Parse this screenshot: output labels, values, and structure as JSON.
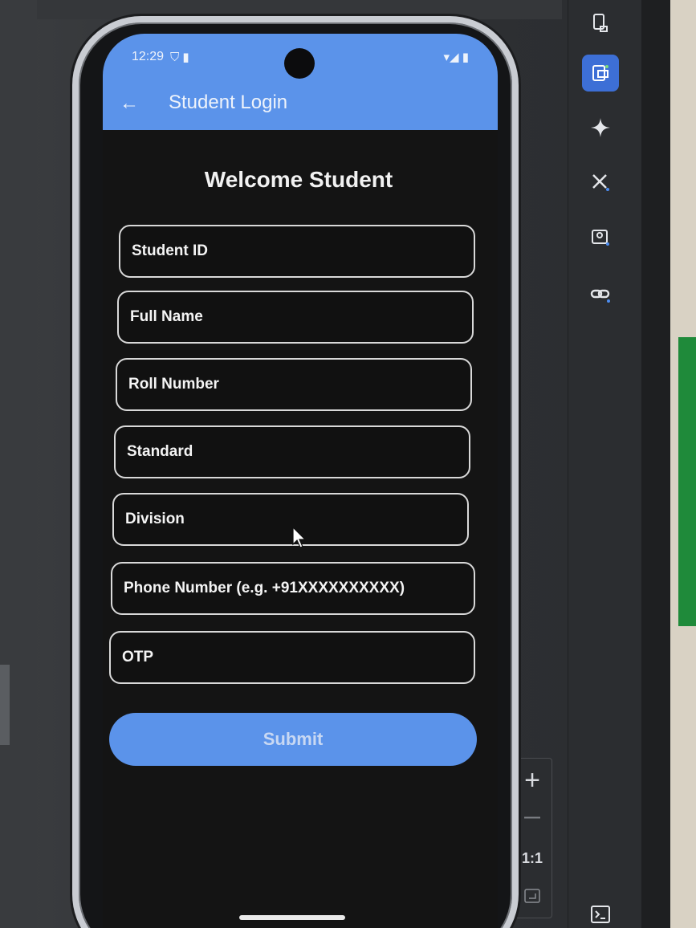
{
  "status_bar": {
    "time": "12:29",
    "left_icons": "⛉ ▮",
    "right_icons": "▾◢ ▮"
  },
  "app_bar": {
    "back_icon": "←",
    "title": "Student Login"
  },
  "form": {
    "heading": "Welcome Student",
    "fields": [
      {
        "label": "Student ID"
      },
      {
        "label": "Full Name"
      },
      {
        "label": "Roll Number"
      },
      {
        "label": "Standard"
      },
      {
        "label": "Division"
      },
      {
        "label": "Phone Number (e.g. +91XXXXXXXXXX)"
      },
      {
        "label": "OTP"
      }
    ],
    "submit_label": "Submit"
  },
  "zoom_panel": {
    "zoom_in": "+",
    "zoom_out": "—",
    "actual_size": "1:1"
  },
  "colors": {
    "accent": "#5b93ea",
    "screen_bg": "#141414",
    "field_border": "#d9d9d9"
  }
}
